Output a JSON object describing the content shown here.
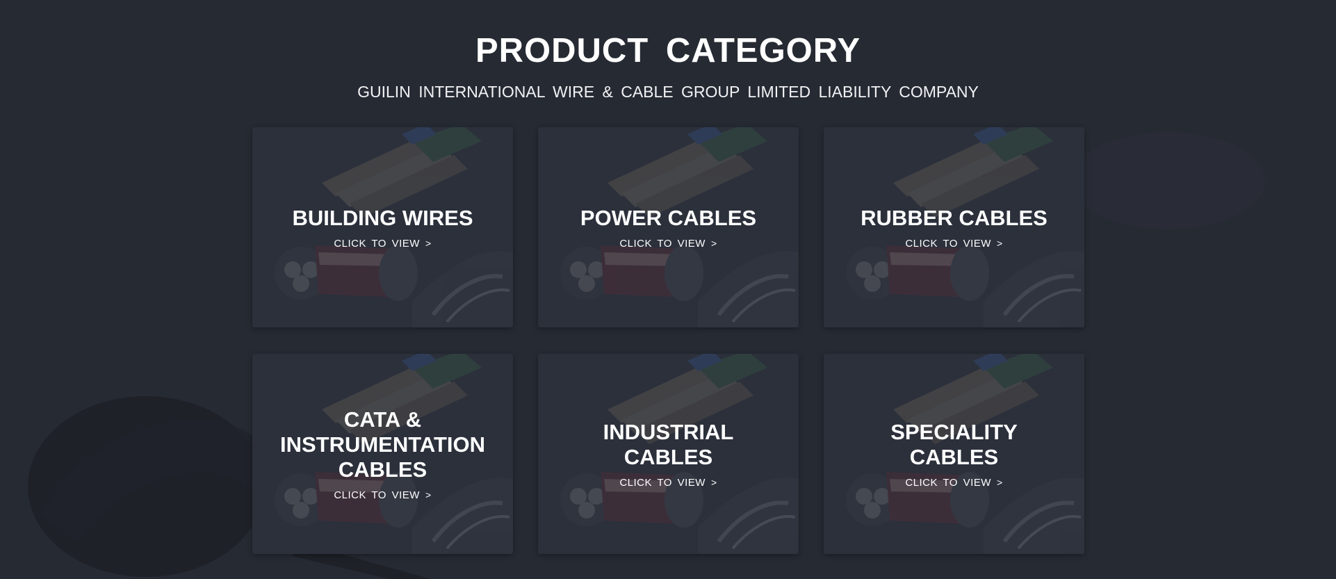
{
  "header": {
    "title": "PRODUCT  CATEGORY",
    "subtitle": "GUILIN INTERNATIONAL WIRE & CABLE GROUP LIMITED LIABILITY COMPANY"
  },
  "categories": [
    {
      "title": "BUILDING WIRES",
      "link": "CLICK TO VIEW",
      "arrow": ">"
    },
    {
      "title": "POWER CABLES",
      "link": "CLICK TO VIEW",
      "arrow": ">"
    },
    {
      "title": "RUBBER CABLES",
      "link": "CLICK TO VIEW",
      "arrow": ">"
    },
    {
      "title": "CATA & INSTRUMENTATION CABLES",
      "link": "CLICK TO VIEW",
      "arrow": ">"
    },
    {
      "title": "INDUSTRIAL CABLES",
      "link": "CLICK TO VIEW",
      "arrow": ">"
    },
    {
      "title": "SPECIALITY CABLES",
      "link": "CLICK TO VIEW",
      "arrow": ">"
    }
  ],
  "colors": {
    "page_bg": "#262a33",
    "card_bg": "#2b303b",
    "text": "#ffffff"
  },
  "icons": {
    "card_background": "cable-cross-section-image",
    "card_arrow": "chevron-right-icon"
  }
}
